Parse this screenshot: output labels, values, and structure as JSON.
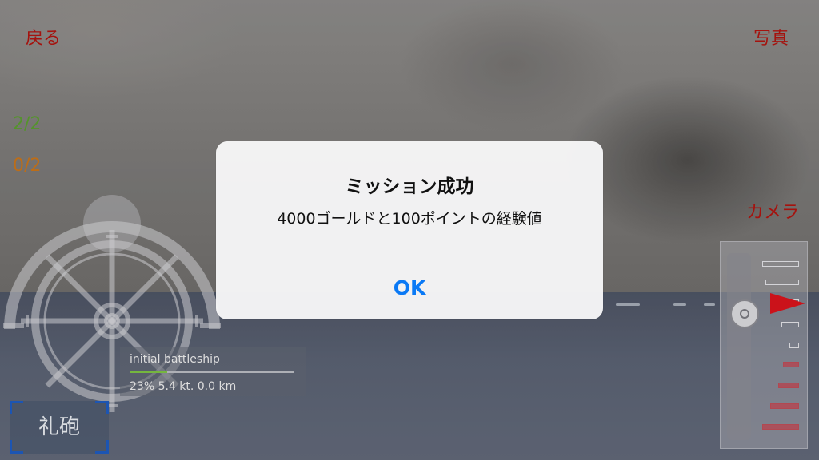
{
  "header": {
    "back_label": "戻る",
    "photo_label": "写真",
    "camera_label": "カメラ"
  },
  "counters": [
    {
      "text": "2/2",
      "color": "#5a9e2e"
    },
    {
      "text": "0/2",
      "color": "#c8741a"
    }
  ],
  "ship_status": {
    "name": "initial battleship",
    "info": "23% 5.4 kt. 0.0 km",
    "progress_percent": 23
  },
  "salute_button": {
    "label": "礼砲"
  },
  "alert": {
    "title": "ミッション成功",
    "message": "4000ゴールドと100ポイントの経験値",
    "ok_label": "OK"
  },
  "colors": {
    "accent_red": "#b0140f",
    "ok_blue": "#0a79f5",
    "bracket_blue": "#1e5bbf"
  },
  "icons": [
    "ship-wheel-icon",
    "throttle-arrow-icon"
  ]
}
